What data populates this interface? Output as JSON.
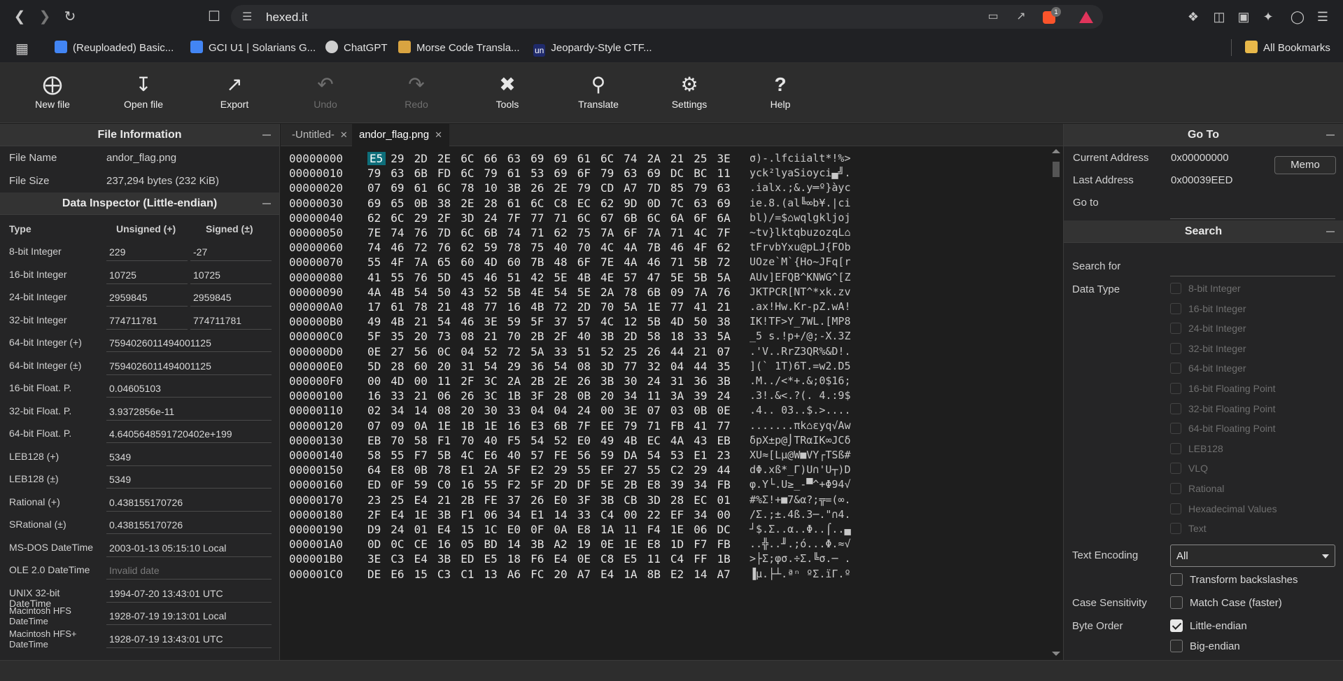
{
  "browser": {
    "url": "hexed.it",
    "bookmarks": [
      {
        "label": "(Reuploaded) Basic...",
        "color": "#4285f4"
      },
      {
        "label": "GCI U1 | Solarians G...",
        "color": "#4285f4"
      },
      {
        "label": "ChatGPT",
        "color": "#bbbbbb"
      },
      {
        "label": "Morse Code Transla...",
        "color": "#d9a441"
      },
      {
        "label": "Jeopardy-Style CTF...",
        "color": "#1f2a6b"
      }
    ],
    "fav_text_5": "un",
    "brave_badge": "1",
    "all_bookmarks": "All Bookmarks"
  },
  "toolbar": {
    "new_file": "New file",
    "open_file": "Open file",
    "export": "Export",
    "undo": "Undo",
    "redo": "Redo",
    "tools": "Tools",
    "translate": "Translate",
    "settings": "Settings",
    "help": "Help"
  },
  "file_info": {
    "title": "File Information",
    "name_label": "File Name",
    "name_value": "andor_flag.png",
    "size_label": "File Size",
    "size_value": "237,294 bytes (232 KiB)"
  },
  "inspector": {
    "title": "Data Inspector (Little-endian)",
    "col_type": "Type",
    "col_unsigned": "Unsigned (+)",
    "col_signed": "Signed (±)",
    "rows": [
      {
        "k": "8-bit Integer",
        "u": "229",
        "s": "-27"
      },
      {
        "k": "16-bit Integer",
        "u": "10725",
        "s": "10725"
      },
      {
        "k": "24-bit Integer",
        "u": "2959845",
        "s": "2959845"
      },
      {
        "k": "32-bit Integer",
        "u": "774711781",
        "s": "774711781"
      },
      {
        "k": "64-bit Integer (+)",
        "v": "7594026011494001125"
      },
      {
        "k": "64-bit Integer (±)",
        "v": "7594026011494001125"
      },
      {
        "k": "16-bit Float. P.",
        "v": "0.04605103"
      },
      {
        "k": "32-bit Float. P.",
        "v": "3.9372856e-11"
      },
      {
        "k": "64-bit Float. P.",
        "v": "4.6405648591720402e+199"
      },
      {
        "k": "LEB128 (+)",
        "v": "5349"
      },
      {
        "k": "LEB128 (±)",
        "v": "5349"
      },
      {
        "k": "Rational (+)",
        "v": "0.438155170726"
      },
      {
        "k": "SRational (±)",
        "v": "0.438155170726"
      },
      {
        "k": "MS-DOS DateTime",
        "v": "2003-01-13 05:15:10 Local"
      },
      {
        "k": "OLE 2.0 DateTime",
        "v": "Invalid date",
        "muted": true
      },
      {
        "k": "UNIX 32-bit DateTime",
        "v": "1994-07-20 13:43:01 UTC"
      },
      {
        "k": "Macintosh HFS DateTime",
        "v": "1928-07-19 19:13:01 Local",
        "two": true
      },
      {
        "k": "Macintosh HFS+ DateTime",
        "v": "1928-07-19 13:43:01 UTC",
        "two": true
      }
    ]
  },
  "tabs": [
    {
      "label": "-Untitled-",
      "active": false
    },
    {
      "label": "andor_flag.png",
      "active": true
    }
  ],
  "hex": {
    "rows": [
      {
        "a": "00000000",
        "b": "E5 29 2D 2E 6C 66 63 69 69 61 6C 74 2A 21 25 3E",
        "t": "σ)-.lfciialt*!%>"
      },
      {
        "a": "00000010",
        "b": "79 63 6B FD 6C 79 61 53 69 6F 79 63 69 DC BC 11",
        "t": "yck²lyaSioyci▄╝."
      },
      {
        "a": "00000020",
        "b": "07 69 61 6C 78 10 3B 26 2E 79 CD A7 7D 85 79 63",
        "t": ".ialx.;&.y═º}àyc"
      },
      {
        "a": "00000030",
        "b": "69 65 0B 38 2E 28 61 6C C8 EC 62 9D 0D 7C 63 69",
        "t": "ie.8.(al╚∞b¥.|ci"
      },
      {
        "a": "00000040",
        "b": "62 6C 29 2F 3D 24 7F 77 71 6C 67 6B 6C 6A 6F 6A",
        "t": "bl)/=$⌂wqlgkljoj"
      },
      {
        "a": "00000050",
        "b": "7E 74 76 7D 6C 6B 74 71 62 75 7A 6F 7A 71 4C 7F",
        "t": "~tv}lktqbuzozqL⌂"
      },
      {
        "a": "00000060",
        "b": "74 46 72 76 62 59 78 75 40 70 4C 4A 7B 46 4F 62",
        "t": "tFrvbYxu@pLJ{FOb"
      },
      {
        "a": "00000070",
        "b": "55 4F 7A 65 60 4D 60 7B 48 6F 7E 4A 46 71 5B 72",
        "t": "UOze`M`{Ho~JFq[r"
      },
      {
        "a": "00000080",
        "b": "41 55 76 5D 45 46 51 42 5E 4B 4E 57 47 5E 5B 5A",
        "t": "AUv]EFQB^KNWG^[Z"
      },
      {
        "a": "00000090",
        "b": "4A 4B 54 50 43 52 5B 4E 54 5E 2A 78 6B 09 7A 76",
        "t": "JKTPCR[NT^*xk.zv"
      },
      {
        "a": "000000A0",
        "b": "17 61 78 21 48 77 16 4B 72 2D 70 5A 1E 77 41 21",
        "t": ".ax!Hw.Kr-pZ.wA!"
      },
      {
        "a": "000000B0",
        "b": "49 4B 21 54 46 3E 59 5F 37 57 4C 12 5B 4D 50 38",
        "t": "IK!TF>Y_7WL.[MP8"
      },
      {
        "a": "000000C0",
        "b": "5F 35 20 73 08 21 70 2B 2F 40 3B 2D 58 18 33 5A",
        "t": "_5 s.!p+/@;-X.3Z"
      },
      {
        "a": "000000D0",
        "b": "0E 27 56 0C 04 52 72 5A 33 51 52 25 26 44 21 07",
        "t": ".'V..RrZ3QR%&D!."
      },
      {
        "a": "000000E0",
        "b": "5D 28 60 20 31 54 29 36 54 08 3D 77 32 04 44 35",
        "t": "](` 1T)6T.=w2.D5"
      },
      {
        "a": "000000F0",
        "b": "00 4D 00 11 2F 3C 2A 2B 2E 26 3B 30 24 31 36 3B",
        "t": ".M../<*+.&;0$16;"
      },
      {
        "a": "00000100",
        "b": "16 33 21 06 26 3C 1B 3F 28 0B 20 34 11 3A 39 24",
        "t": ".3!.&<.?(. 4.:9$"
      },
      {
        "a": "00000110",
        "b": "02 34 14 08 20 30 33 04 04 24 00 3E 07 03 0B 0E",
        "t": ".4.. 03..$.>...."
      },
      {
        "a": "00000120",
        "b": "07 09 0A 1E 1B 1E 16 E3 6B 7F EE 79 71 FB 41 77",
        "t": ".......πk⌂εyq√Aw"
      },
      {
        "a": "00000130",
        "b": "EB 70 58 F1 70 40 F5 54 52 E0 49 4B EC 4A 43 EB",
        "t": "δpX±p@⌡TRαIK∞JCδ"
      },
      {
        "a": "00000140",
        "b": "58 55 F7 5B 4C E6 40 57 FE 56 59 DA 54 53 E1 23",
        "t": "XU≈[Lµ@W■VY┌TSß#"
      },
      {
        "a": "00000150",
        "b": "64 E8 0B 78 E1 2A 5F E2 29 55 EF 27 55 C2 29 44",
        "t": "dΦ.xß*_Γ)U∩'U┬)D"
      },
      {
        "a": "00000160",
        "b": "ED 0F 59 C0 16 55 F2 5F 2D DF 5E 2B E8 39 34 FB",
        "t": "φ.Y└.U≥_-▀^+Φ94√"
      },
      {
        "a": "00000170",
        "b": "23 25 E4 21 2B FE 37 26 E0 3F 3B CB 3D 28 EC 01",
        "t": "#%Σ!+■7&α?;╦=(∞."
      },
      {
        "a": "00000180",
        "b": "2F E4 1E 3B F1 06 34 E1 14 33 C4 00 22 EF 34 00",
        "t": "/Σ.;±.4ß.3─.\"∩4."
      },
      {
        "a": "00000190",
        "b": "D9 24 01 E4 15 1C E0 0F 0A E8 1A 11 F4 1E 06 DC",
        "t": "┘$.Σ..α..Φ..⌠..▄"
      },
      {
        "a": "000001A0",
        "b": "0D 0C CE 16 05 BD 14 3B A2 19 0E 1E E8 1D F7 FB",
        "t": "..╬..╜.;ó...Φ.≈√"
      },
      {
        "a": "000001B0",
        "b": "3E C3 E4 3B ED E5 18 F6 E4 0E C8 E5 11 C4 FF 1B",
        "t": ">├Σ;φσ.÷Σ.╚σ.─ ."
      },
      {
        "a": "000001C0",
        "b": "DE E6 15 C3 C1 13 A6 FC 20 A7 E4 1A 8B E2 14 A7",
        "t": "▐µ.├┴.ªⁿ ºΣ.ïΓ.º"
      }
    ]
  },
  "goto": {
    "title": "Go To",
    "current_label": "Current Address",
    "current_value": "0x00000000",
    "memo": "Memo",
    "last_label": "Last Address",
    "last_value": "0x00039EED",
    "goto_label": "Go to"
  },
  "search": {
    "title": "Search",
    "search_for": "Search for",
    "data_type": "Data Type",
    "types": [
      "8-bit Integer",
      "16-bit Integer",
      "24-bit Integer",
      "32-bit Integer",
      "64-bit Integer",
      "16-bit Floating Point",
      "32-bit Floating Point",
      "64-bit Floating Point",
      "LEB128",
      "VLQ",
      "Rational",
      "Hexadecimal Values",
      "Text"
    ],
    "text_encoding": "Text Encoding",
    "encoding_value": "All",
    "transform": "Transform backslashes",
    "case_label": "Case Sensitivity",
    "match_case": "Match Case (faster)",
    "byte_order": "Byte Order",
    "little": "Little-endian",
    "big": "Big-endian"
  }
}
